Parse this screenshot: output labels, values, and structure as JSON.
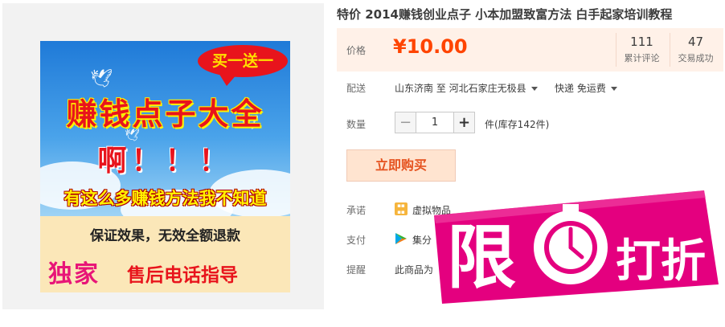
{
  "product_image": {
    "badge_text": "买一送一",
    "headline": "赚钱点子大全",
    "exclaim": "啊！！！",
    "subline": "有这么多赚钱方法我不知道",
    "guarantee": "保证效果，无效全额退款",
    "exclusive": "独家",
    "phone_guide": "售后电话指导"
  },
  "title": "特价 2014赚钱创业点子 小本加盟致富方法 白手起家培训教程",
  "price": {
    "label": "价格",
    "value": "¥10.00"
  },
  "stats": [
    {
      "number": "111",
      "label": "累计评论"
    },
    {
      "number": "47",
      "label": "交易成功"
    }
  ],
  "shipping": {
    "label": "配送",
    "route": "山东济南 至  河北石家庄无极县",
    "method": "快递 免运费"
  },
  "quantity": {
    "label": "数量",
    "minus": "−",
    "value": "1",
    "plus": "+",
    "stock": "件(库存142件)"
  },
  "buy_button": "立即购买",
  "promise": {
    "label": "承诺",
    "text": "虚拟物品"
  },
  "payment": {
    "label": "支付",
    "text": "集分"
  },
  "reminder": {
    "label": "提醒",
    "text": "此商品为"
  },
  "promo_badge": {
    "text_limit": "限",
    "text_discount": "打折"
  },
  "colors": {
    "price": "#ff4400",
    "promo": "#e4007f",
    "buy_button_bg": "#ffe4d0"
  }
}
